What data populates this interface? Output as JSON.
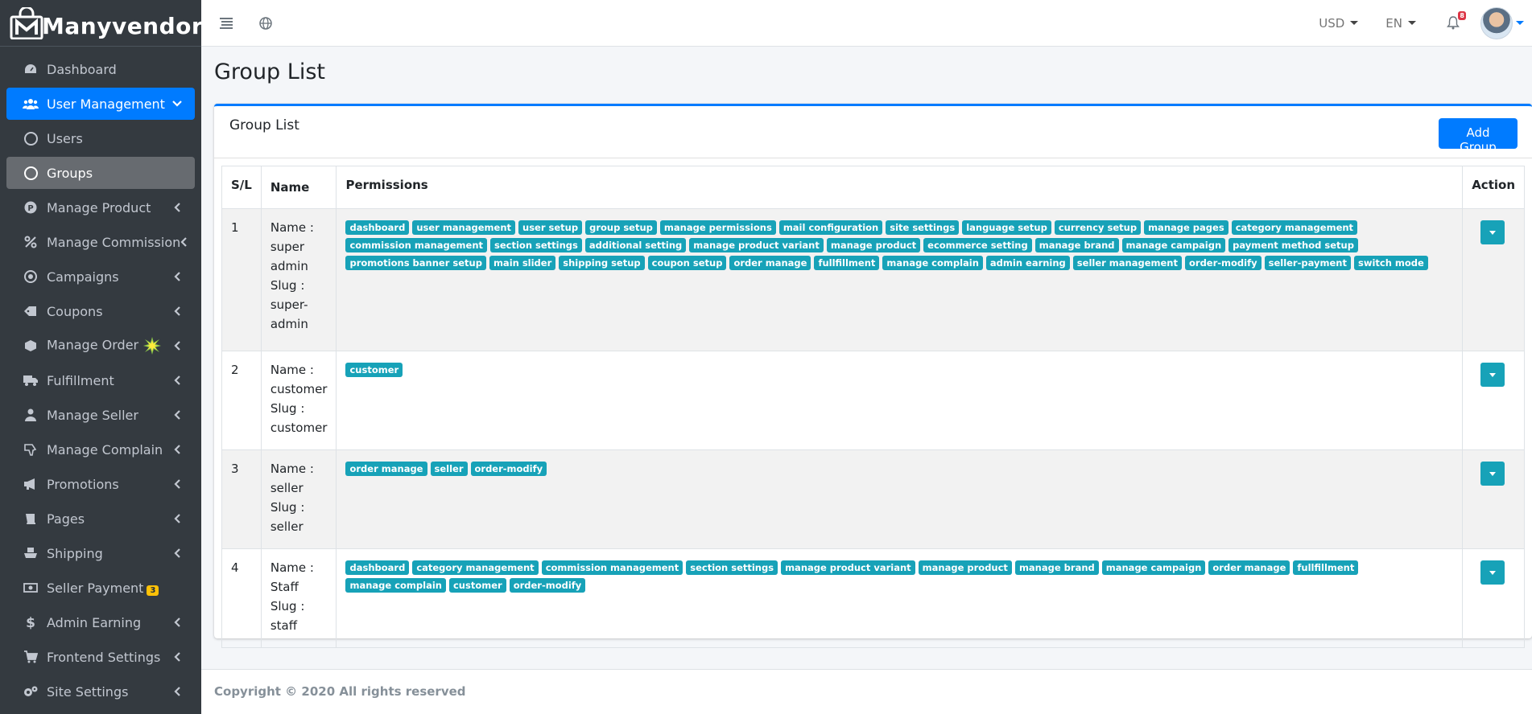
{
  "brand": {
    "name": "Manyvendor"
  },
  "sidebar": {
    "items": [
      {
        "label": "Dashboard",
        "icon": "dashboard-icon",
        "state": "normal",
        "arrow": false
      },
      {
        "label": "User Management",
        "icon": "users-icon",
        "state": "active",
        "arrow": "down"
      },
      {
        "label": "Users",
        "icon": "circle-icon",
        "state": "normal",
        "arrow": false
      },
      {
        "label": "Groups",
        "icon": "circle-icon",
        "state": "sub-active",
        "arrow": false
      },
      {
        "label": "Manage Product",
        "icon": "product-icon",
        "state": "normal",
        "arrow": "left"
      },
      {
        "label": "Manage Commission",
        "icon": "percent-icon",
        "state": "normal",
        "arrow": "left"
      },
      {
        "label": "Campaigns",
        "icon": "campaign-icon",
        "state": "normal",
        "arrow": "left"
      },
      {
        "label": "Coupons",
        "icon": "ticket-icon",
        "state": "normal",
        "arrow": "left"
      },
      {
        "label": "Manage Order",
        "icon": "box-icon",
        "state": "normal",
        "arrow": "left",
        "extra": "new-burst-icon"
      },
      {
        "label": "Fulfillment",
        "icon": "truck-icon",
        "state": "normal",
        "arrow": "left"
      },
      {
        "label": "Manage Seller",
        "icon": "user-icon",
        "state": "normal",
        "arrow": "left"
      },
      {
        "label": "Manage Complain",
        "icon": "thumbs-down-icon",
        "state": "normal",
        "arrow": "left"
      },
      {
        "label": "Promotions",
        "icon": "bullhorn-icon",
        "state": "normal",
        "arrow": "left"
      },
      {
        "label": "Pages",
        "icon": "book-icon",
        "state": "normal",
        "arrow": "left"
      },
      {
        "label": "Shipping",
        "icon": "shipping-icon",
        "state": "normal",
        "arrow": "left"
      },
      {
        "label": "Seller Payment",
        "icon": "money-icon",
        "state": "normal",
        "arrow": false,
        "badge": "3"
      },
      {
        "label": "Admin Earning",
        "icon": "dollar-icon",
        "state": "normal",
        "arrow": "left"
      },
      {
        "label": "Frontend Settings",
        "icon": "cart-icon",
        "state": "normal",
        "arrow": "left"
      },
      {
        "label": "Site Settings",
        "icon": "cogs-icon",
        "state": "normal",
        "arrow": "left"
      }
    ]
  },
  "topbar": {
    "currency": "USD",
    "language": "EN",
    "notification_count": "8"
  },
  "page": {
    "title": "Group List"
  },
  "card": {
    "title": "Group List",
    "add_button": "Add Group"
  },
  "table": {
    "headers": {
      "sl": "S/L",
      "name": "Name",
      "permissions": "Permissions",
      "action": "Action"
    },
    "rows": [
      {
        "sl": "1",
        "name_lines": [
          "Name :",
          "super",
          "admin",
          "Slug :",
          "super-",
          "admin"
        ],
        "permissions": [
          "dashboard",
          "user management",
          "user setup",
          "group setup",
          "manage permissions",
          "mail configuration",
          "site settings",
          "language setup",
          "currency setup",
          "manage pages",
          "category management",
          "commission management",
          "section settings",
          "additional setting",
          "manage product variant",
          "manage product",
          "ecommerce setting",
          "manage brand",
          "manage campaign",
          "payment method setup",
          "promotions banner setup",
          "main slider",
          "shipping setup",
          "coupon setup",
          "order manage",
          "fullfillment",
          "manage complain",
          "admin earning",
          "seller management",
          "order-modify",
          "seller-payment",
          "switch mode"
        ]
      },
      {
        "sl": "2",
        "name_lines": [
          "Name :",
          "customer",
          "Slug :",
          "customer"
        ],
        "permissions": [
          "customer"
        ]
      },
      {
        "sl": "3",
        "name_lines": [
          "Name :",
          "seller",
          "Slug :",
          "seller"
        ],
        "permissions": [
          "order manage",
          "seller",
          "order-modify"
        ]
      },
      {
        "sl": "4",
        "name_lines": [
          "Name :",
          "Staff",
          "Slug :",
          "staff"
        ],
        "permissions": [
          "dashboard",
          "category management",
          "commission management",
          "section settings",
          "manage product variant",
          "manage product",
          "manage brand",
          "manage campaign",
          "order manage",
          "fullfillment",
          "manage complain",
          "customer",
          "order-modify"
        ]
      }
    ]
  },
  "footer": {
    "text": "Copyright © 2020 All rights reserved"
  },
  "colors": {
    "primary": "#007bff",
    "info": "#17a2b8",
    "sidebar": "#343a40",
    "warning": "#ffc107",
    "danger": "#dc3545"
  }
}
